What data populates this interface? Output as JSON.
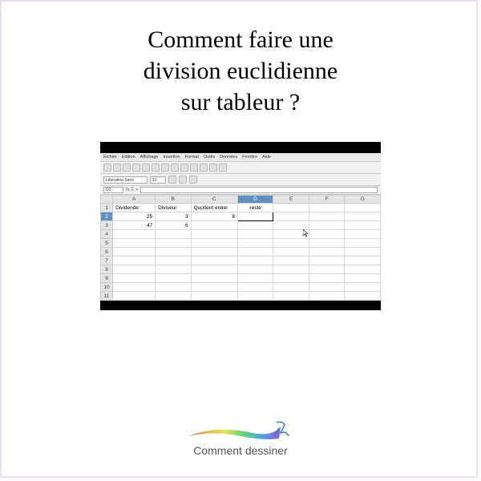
{
  "title_l1": "Comment faire une",
  "title_l2": "division euclidienne",
  "title_l3": "sur tableur ?",
  "menubar": {
    "items": [
      "Eichier",
      "Edition",
      "Affichage",
      "Insertion",
      "Format",
      "Outils",
      "Données",
      "Fenêtre",
      "Aide"
    ]
  },
  "font": {
    "name": "Liberation Sans",
    "size": "10"
  },
  "cellref": "D2",
  "columns": [
    "",
    "A",
    "B",
    "C",
    "D",
    "E",
    "F",
    "G"
  ],
  "rows": [
    "1",
    "2",
    "3",
    "4",
    "5",
    "6",
    "7",
    "8",
    "9",
    "10",
    "11"
  ],
  "headers": {
    "A": "Dividende",
    "B": "Diviseur",
    "C": "Quotient entier",
    "D": "reste"
  },
  "r2": {
    "A": "25",
    "B": "3",
    "C": "8",
    "D": ""
  },
  "r3": {
    "A": "47",
    "B": "6",
    "C": "",
    "D": ""
  },
  "chart_data": {
    "type": "table",
    "columns": [
      "Dividende",
      "Diviseur",
      "Quotient entier",
      "reste"
    ],
    "rows": [
      [
        25,
        3,
        8,
        null
      ],
      [
        47,
        6,
        null,
        null
      ]
    ]
  },
  "logo_text": "Comment dessiner"
}
